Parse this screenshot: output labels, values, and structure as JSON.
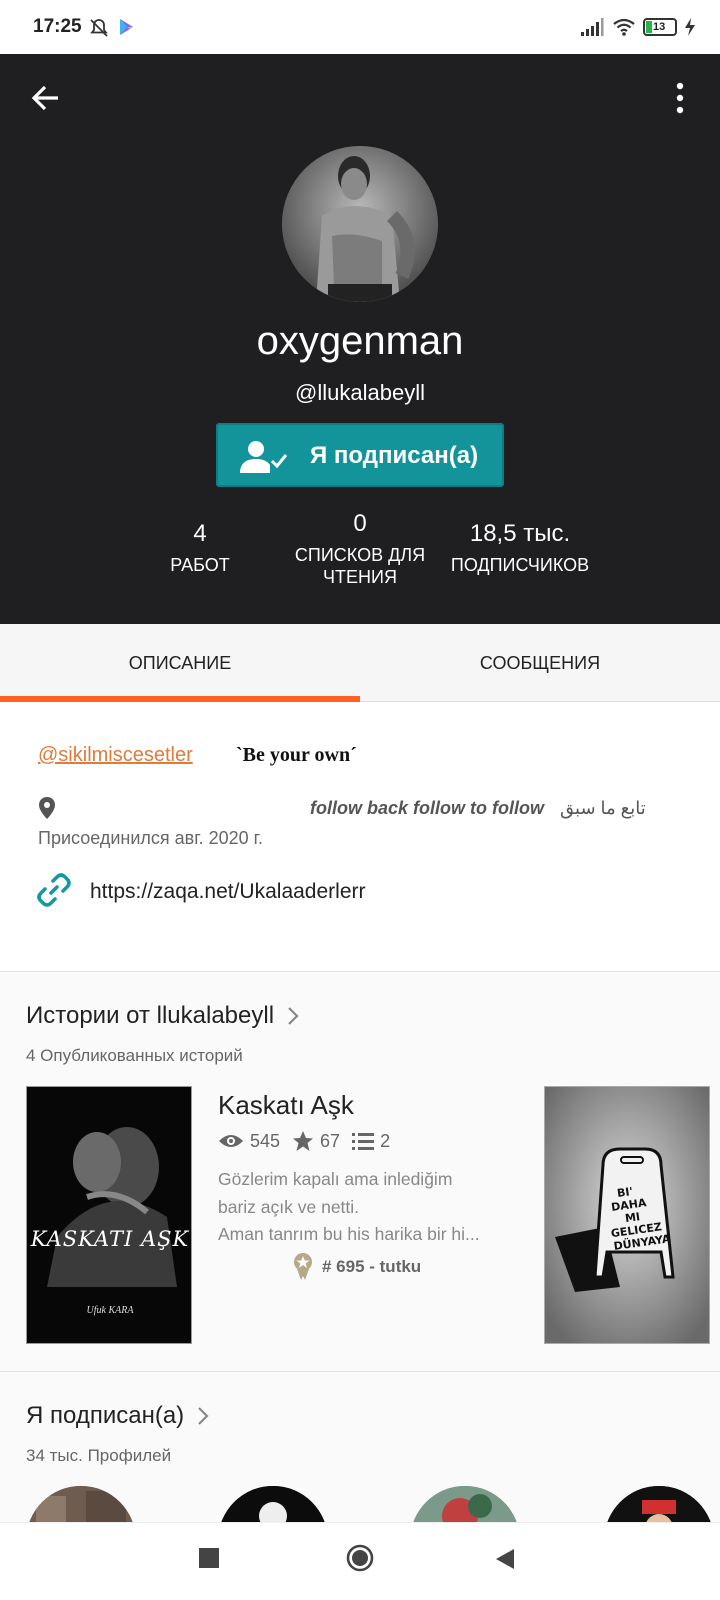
{
  "status_bar": {
    "time": "17:25",
    "battery": "13"
  },
  "profile": {
    "display_name": "oxygenman",
    "username": "@llukalabeyll",
    "follow_label": "Я подписан(а)",
    "stats": [
      {
        "value": "4",
        "label": "РАБОТ"
      },
      {
        "value": "0",
        "label": "СПИСКОВ ДЛЯ ЧТЕНИЯ"
      },
      {
        "value": "18,5 тыс.",
        "label": "ПОДПИСЧИКОВ"
      }
    ]
  },
  "tabs": [
    {
      "label": "ОПИСАНИЕ",
      "active": true
    },
    {
      "label": "СООБЩЕНИЯ",
      "active": false
    }
  ],
  "about": {
    "mention": "@sikilmiscesetler",
    "motto": "ˋBe your ownˊ",
    "location_text": "follow back follow to follow",
    "location_text_ar": "تابع ما سبق",
    "joined": "Присоединился авг. 2020 г.",
    "link": "https://zaqa.net/Ukalaaderlerr"
  },
  "stories": {
    "title": "Истории от llukalabeyll",
    "subtitle": "4 Опубликованных историй",
    "items": [
      {
        "title": "Kaskatı Aşk",
        "reads": "545",
        "votes": "67",
        "parts": "2",
        "description_lines": [
          "Gözlerim kapalı ama inlediğim",
          "bariz açık ve netti.",
          "Aman tanrım bu his harika bir hi..."
        ],
        "rank": "# 695 - tutku",
        "cover_title": "KASKATI AŞK",
        "cover_author": "Ufuk KARA"
      },
      {
        "cover_text": "BI' DAHA MI GELICEZ DÜNYAYA"
      }
    ]
  },
  "following": {
    "title": "Я подписан(а)",
    "subtitle": "34 тыс. Профилей"
  },
  "colors": {
    "header_bg": "#1f1e20",
    "follow_button": "#12949a",
    "tab_indicator": "#ff6122",
    "mention": "#e07b3c"
  }
}
